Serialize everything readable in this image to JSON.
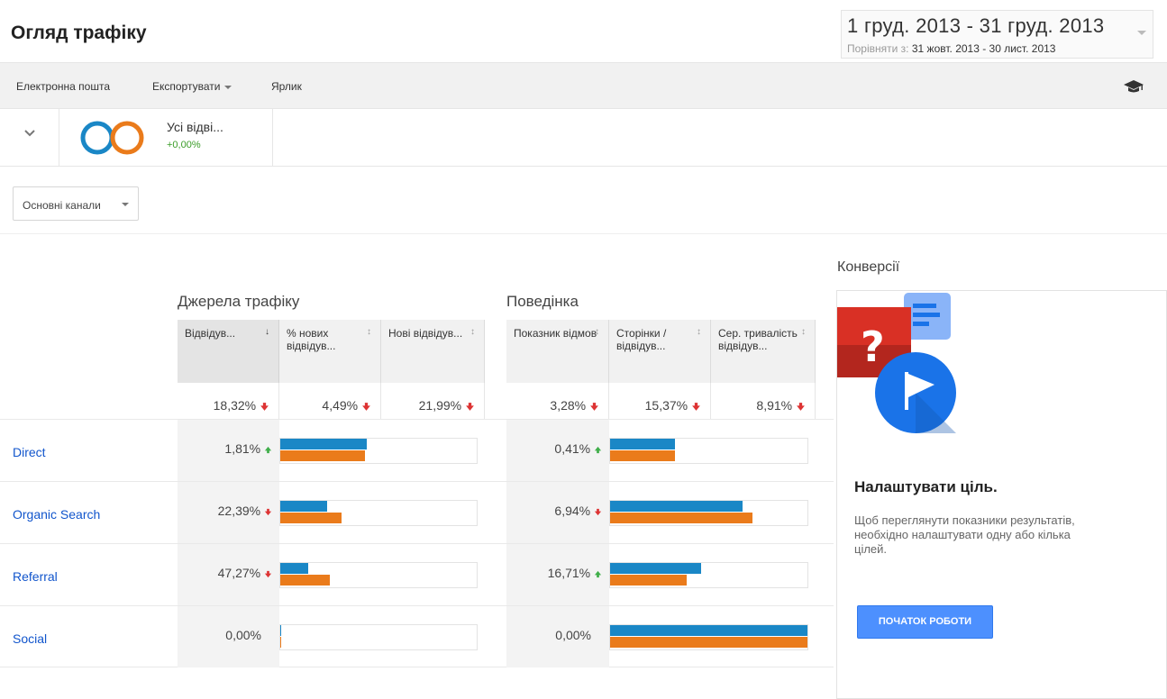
{
  "page": {
    "title": "Огляд трафіку"
  },
  "date": {
    "range": "1 груд. 2013 - 31 груд. 2013",
    "compare_label": "Порівняти з:",
    "compare_range": "31 жовт. 2013 - 30 лист. 2013"
  },
  "toolbar": {
    "email": "Електронна пошта",
    "export": "Експортувати",
    "shortcut": "Ярлик",
    "help_icon": "graduation-cap-icon"
  },
  "segment": {
    "name": "Усі відві...",
    "delta": "+0,00%"
  },
  "dropdown": {
    "label": "Основні канали"
  },
  "groups": {
    "acquisition": "Джерела трафіку",
    "behavior": "Поведінка"
  },
  "columns": [
    {
      "label": "Відвідув...",
      "total_pct": "18,32%"
    },
    {
      "label": "% нових відвідув...",
      "total_pct": "4,49%"
    },
    {
      "label": "Нові відвідув...",
      "total_pct": "21,99%"
    },
    {
      "label": "Показник відмов",
      "total_pct": "3,28%"
    },
    {
      "label": "Сторінки / відвідув...",
      "total_pct": "15,37%"
    },
    {
      "label": "Сер. тривалість відвідув...",
      "total_pct": "8,91%"
    }
  ],
  "rows": [
    {
      "channel": "Direct",
      "visits_pct": "1,81%",
      "visits_trend": "up",
      "visits_bar": [
        0.44,
        0.43
      ],
      "bounce_pct": "0,41%",
      "bounce_trend": "up",
      "pages_bar": [
        0.33,
        0.33
      ]
    },
    {
      "channel": "Organic Search",
      "visits_pct": "22,39%",
      "visits_trend": "down",
      "visits_bar": [
        0.24,
        0.31
      ],
      "bounce_pct": "6,94%",
      "bounce_trend": "down",
      "pages_bar": [
        0.67,
        0.72
      ]
    },
    {
      "channel": "Referral",
      "visits_pct": "47,27%",
      "visits_trend": "down",
      "visits_bar": [
        0.14,
        0.25
      ],
      "bounce_pct": "16,71%",
      "bounce_trend": "up",
      "pages_bar": [
        0.46,
        0.39
      ]
    },
    {
      "channel": "Social",
      "visits_pct": "0,00%",
      "visits_trend": "none",
      "visits_bar": [
        0.005,
        0.005
      ],
      "bounce_pct": "0,00%",
      "bounce_trend": "none",
      "pages_bar": [
        1.0,
        1.0
      ]
    }
  ],
  "conversions": {
    "title": "Конверсії",
    "heading": "Налаштувати ціль.",
    "text": "Щоб переглянути показники результатів, необхідно налаштувати одну або кілька цілей.",
    "button": "ПОЧАТОК РОБОТИ"
  },
  "colors": {
    "series_current": "#1a87c6",
    "series_previous": "#ea7b1b",
    "trend_up": "#3fae49",
    "trend_down": "#dd3333",
    "link": "#1155cc"
  }
}
